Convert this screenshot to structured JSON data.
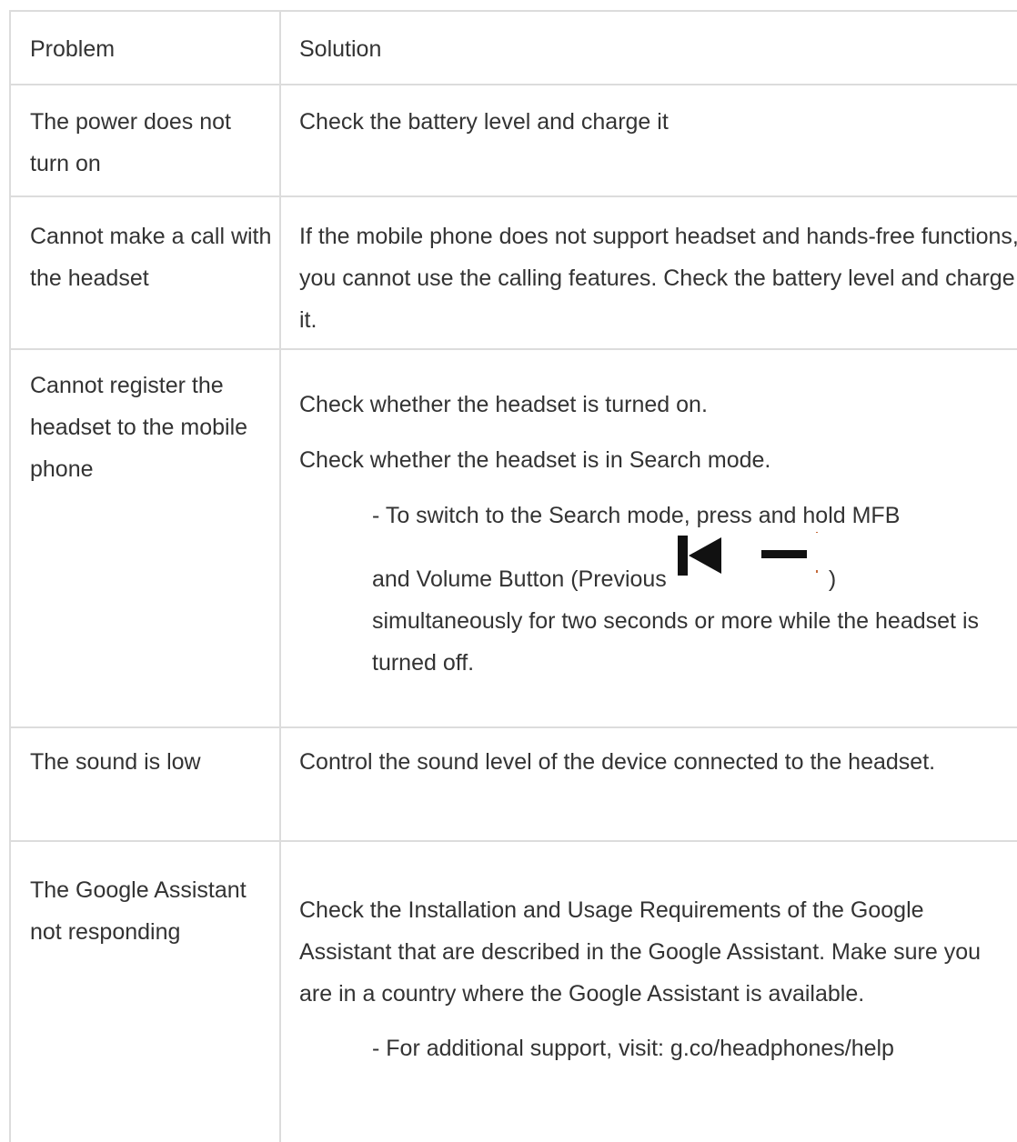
{
  "table": {
    "header": {
      "problem": "Problem",
      "solution": "Solution"
    },
    "rows": [
      {
        "problem": "The power does not turn on",
        "solution": [
          "Check the battery level and charge it"
        ]
      },
      {
        "problem": "Cannot make a call with the headset",
        "solution": [
          "If the mobile phone does not support headset and hands-free functions, you cannot use the calling features. Check the battery level and charge it."
        ]
      },
      {
        "problem": "Cannot register the headset to the mobile phone",
        "solution": [
          "Check whether the headset is turned on.",
          "Check whether the headset is in Search mode.",
          "- To switch to the Search mode, press and hold MFB",
          "and Volume Button (Previous",
          ")",
          "simultaneously for two seconds or more while the headset is turned off."
        ],
        "icon": "previous-volume-down-icon"
      },
      {
        "problem": "The sound is low",
        "solution": [
          "Control the sound level of the device connected to the headset."
        ]
      },
      {
        "problem": "The Google Assistant not responding",
        "solution": [
          "Check the Installation and Usage Requirements of the Google Assistant that are described in the Google Assistant. Make sure you are in a country where the Google Assistant is available.",
          "- For additional support, visit: g.co/headphones/help"
        ]
      }
    ]
  }
}
